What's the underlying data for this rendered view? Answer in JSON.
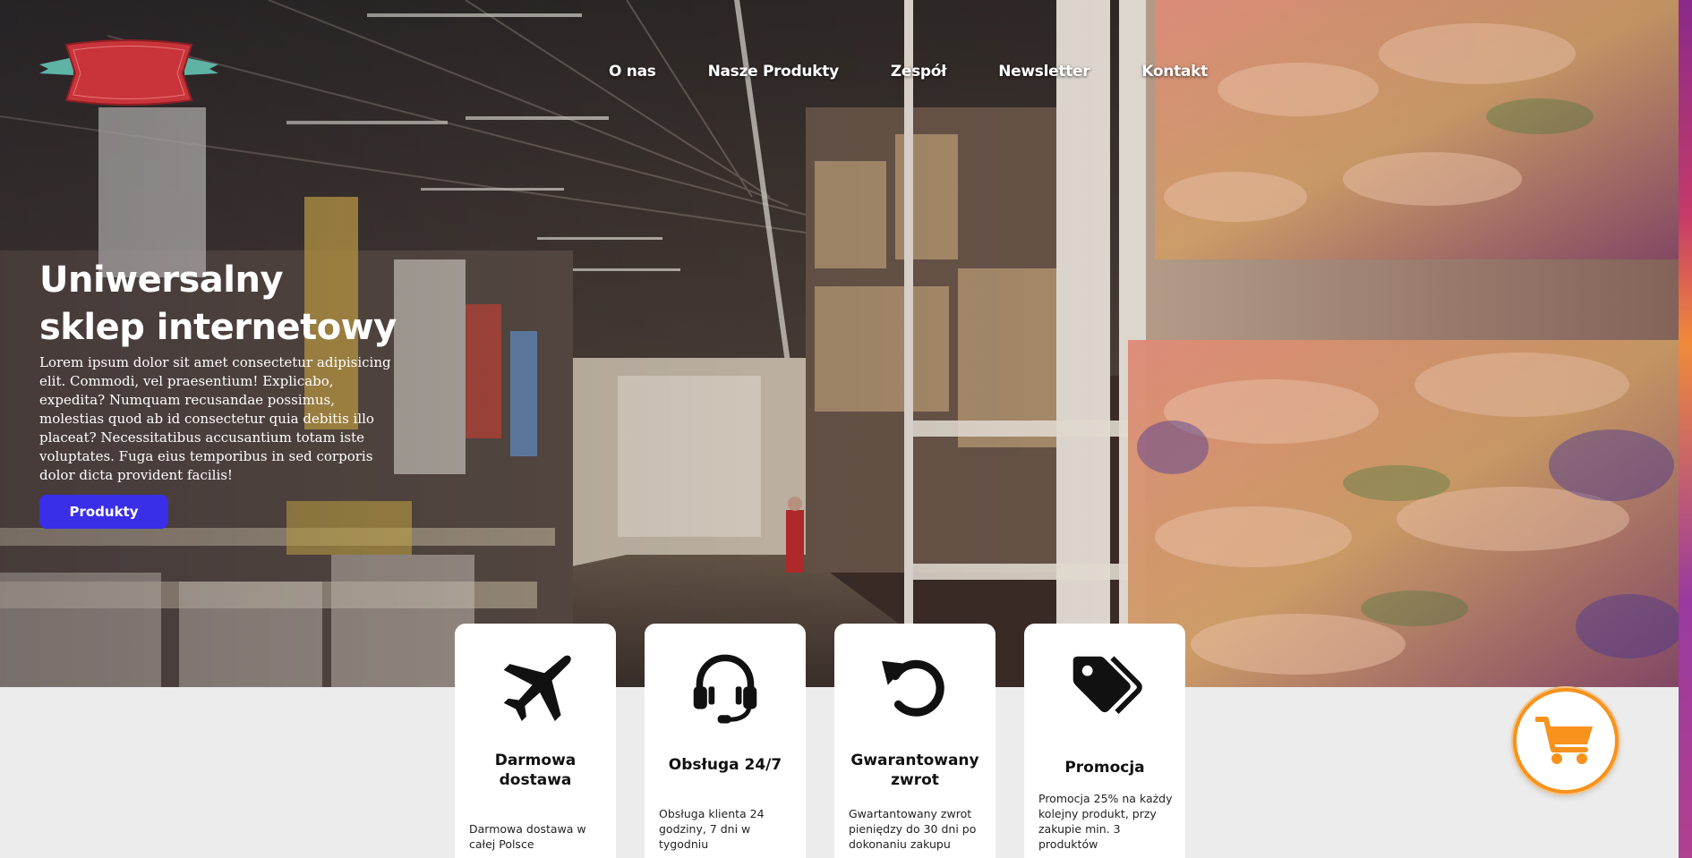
{
  "nav": {
    "items": [
      {
        "label": "O nas"
      },
      {
        "label": "Nasze Produkty"
      },
      {
        "label": "Zespół"
      },
      {
        "label": "Newsletter"
      },
      {
        "label": "Kontakt"
      }
    ]
  },
  "hero": {
    "title": "Uniwersalny sklep internetowy",
    "description": "Lorem ipsum dolor sit amet consectetur adipisicing elit. Commodi, vel praesentium! Explicabo, expedita? Numquam recusandae possimus, molestias quod ab id consectetur quia debitis illo placeat? Necessitatibus accusantium totam iste voluptates. Fuga eius temporibus in sed corporis dolor dicta provident facilis!",
    "button_label": "Produkty"
  },
  "features": [
    {
      "icon": "airplane-icon",
      "title": "Darmowa dostawa",
      "text": "Darmowa dostawa w całej Polsce"
    },
    {
      "icon": "headset-icon",
      "title": "Obsługa 24/7",
      "text": "Obsługa klienta 24 godziny, 7 dni w tygodniu"
    },
    {
      "icon": "undo-icon",
      "title": "Gwarantowany zwrot",
      "text": "Gwartantowany zwrot pieniędzy do 30 dni po dokonaniu zakupu"
    },
    {
      "icon": "tags-icon",
      "title": "Promocja",
      "text": "Promocja 25% na każdy kolejny produkt, przy zakupie min. 3 produktów"
    }
  ],
  "cart": {
    "icon": "cart-icon"
  },
  "colors": {
    "accent": "#3a2ee8",
    "cart_orange": "#f7921e",
    "logo_red": "#c8343a",
    "logo_teal": "#5fb3a4"
  }
}
